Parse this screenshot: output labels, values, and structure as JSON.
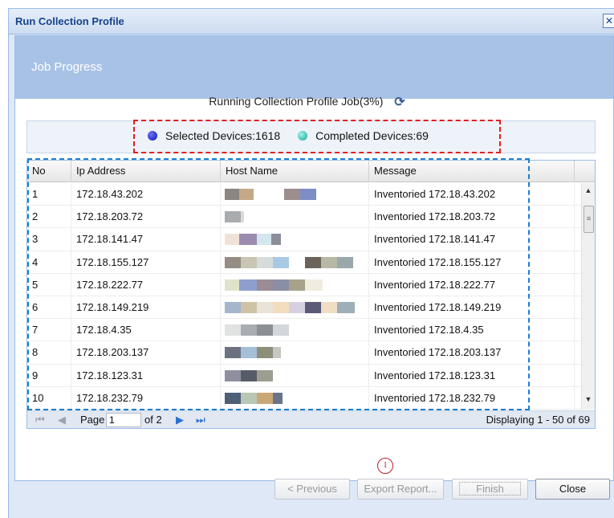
{
  "window": {
    "title": "Run Collection Profile",
    "close_glyph": "✕"
  },
  "header": {
    "title": "Job Progress"
  },
  "status": {
    "text": "Running Collection Profile Job(3%)",
    "icon": "refresh-icon"
  },
  "counts": {
    "selected_label": "Selected Devices:1618",
    "completed_label": "Completed Devices:69",
    "selected_color": "#1a1fc8",
    "completed_color": "#3cc8bd"
  },
  "table": {
    "columns": [
      "No",
      "Ip Address",
      "Host Name",
      "Message"
    ],
    "rows": [
      {
        "no": "1",
        "ip": "172.18.43.202",
        "message": "Inventoried 172.18.43.202"
      },
      {
        "no": "2",
        "ip": "172.18.203.72",
        "message": "Inventoried 172.18.203.72"
      },
      {
        "no": "3",
        "ip": "172.18.141.47",
        "message": "Inventoried 172.18.141.47"
      },
      {
        "no": "4",
        "ip": "172.18.155.127",
        "message": "Inventoried 172.18.155.127"
      },
      {
        "no": "5",
        "ip": "172.18.222.77",
        "message": "Inventoried 172.18.222.77"
      },
      {
        "no": "6",
        "ip": "172.18.149.219",
        "message": "Inventoried 172.18.149.219"
      },
      {
        "no": "7",
        "ip": "172.18.4.35",
        "message": "Inventoried 172.18.4.35"
      },
      {
        "no": "8",
        "ip": "172.18.203.137",
        "message": "Inventoried 172.18.203.137"
      },
      {
        "no": "9",
        "ip": "172.18.123.31",
        "message": "Inventoried 172.18.123.31"
      },
      {
        "no": "10",
        "ip": "172.18.232.79",
        "message": "Inventoried 172.18.232.79"
      }
    ]
  },
  "pager": {
    "page_label": "Page",
    "page_value": "1",
    "of_label": "of 2",
    "display_text": "Displaying 1 - 50 of 69"
  },
  "annotation": {
    "marker": "1"
  },
  "buttons": {
    "previous": "< Previous",
    "export": "Export Report...",
    "finish": "Finish",
    "close": "Close"
  }
}
